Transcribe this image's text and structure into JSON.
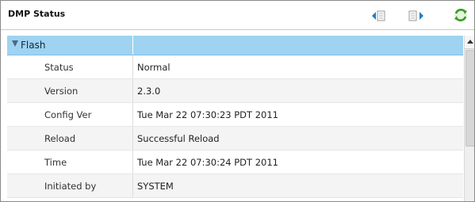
{
  "panel": {
    "title": "DMP Status",
    "icons": {
      "prev": "previous-page-icon",
      "next": "next-page-icon",
      "refresh": "refresh-icon"
    },
    "colors": {
      "group_row": "#9fd3f1",
      "nav_arrow": "#1e7ecb",
      "refresh_green": "#3a9a2a"
    }
  },
  "group": {
    "label": "Flash",
    "expanded": true
  },
  "rows": [
    {
      "label": "Status",
      "value": "Normal"
    },
    {
      "label": "Version",
      "value": "2.3.0"
    },
    {
      "label": "Config Ver",
      "value": "Tue Mar 22 07:30:23 PDT 2011"
    },
    {
      "label": "Reload",
      "value": "Successful Reload"
    },
    {
      "label": "Time",
      "value": "Tue Mar 22 07:30:24 PDT 2011"
    },
    {
      "label": "Initiated by",
      "value": "SYSTEM"
    }
  ]
}
